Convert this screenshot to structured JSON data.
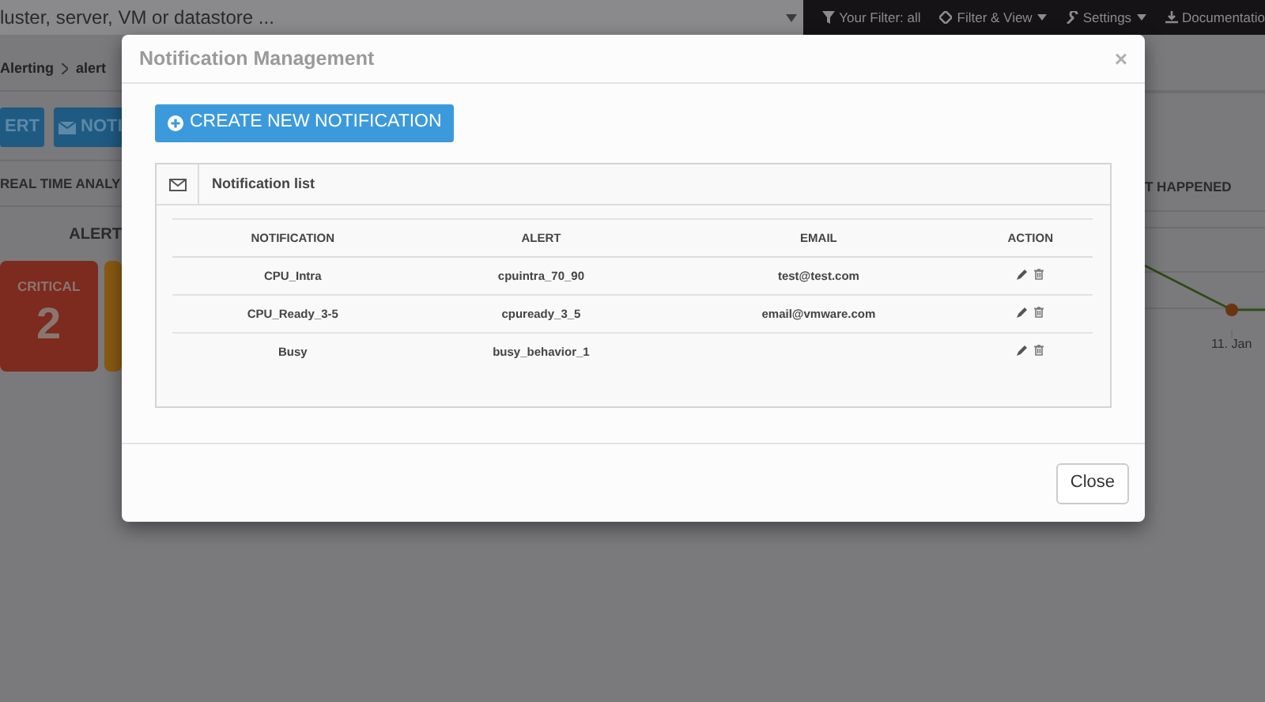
{
  "topbar": {
    "search": {
      "value": "luster, server, VM or datastore ..."
    },
    "menu": [
      {
        "label": "Your Filter: all",
        "dropdown": false
      },
      {
        "label": "Filter & View",
        "dropdown": true
      },
      {
        "label": "Settings",
        "dropdown": true
      },
      {
        "label": "Documentatio",
        "dropdown": false
      }
    ]
  },
  "breadcrumb": [
    "Alerting",
    "alert"
  ],
  "buttons": [
    "ERT",
    "NOTI"
  ],
  "section_title": "REAL TIME ANALY",
  "alerts_title": "ALERT",
  "alert_cards": [
    {
      "label": "CRITICAL",
      "count": "2",
      "color": "#7d2a1f"
    },
    {
      "color": "#8a5a12"
    }
  ],
  "right_panel": {
    "title": "T HAPPENED",
    "axis_label": "11. Jan"
  },
  "modal": {
    "title": "Notification Management",
    "close_symbol": "×",
    "create_button": "CREATE NEW NOTIFICATION",
    "panel_title": "Notification list",
    "table": {
      "columns": [
        "NOTIFICATION",
        "ALERT",
        "EMAIL",
        "ACTION"
      ],
      "rows": [
        {
          "notification": "CPU_Intra",
          "alert": "cpuintra_70_90",
          "email": "test@test.com"
        },
        {
          "notification": "CPU_Ready_3-5",
          "alert": "cpuready_3_5",
          "email": "email@vmware.com"
        },
        {
          "notification": "Busy",
          "alert": "busy_behavior_1"
        }
      ]
    },
    "footer_button": "Close"
  }
}
